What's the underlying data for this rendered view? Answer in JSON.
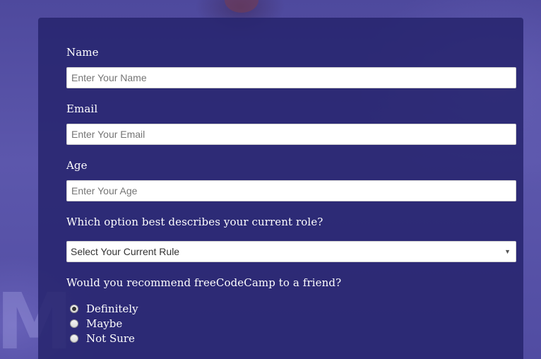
{
  "form": {
    "name": {
      "label": "Name",
      "placeholder": "Enter Your Name"
    },
    "email": {
      "label": "Email",
      "placeholder": "Enter Your Email"
    },
    "age": {
      "label": "Age",
      "placeholder": "Enter Your Age"
    },
    "role": {
      "label": "Which option best describes your current role?",
      "selected": "Select Your Current Rule"
    },
    "recommend": {
      "label": "Would you recommend freeCodeCamp to a friend?",
      "options": [
        {
          "label": "Definitely",
          "checked": true
        },
        {
          "label": "Maybe",
          "checked": false
        },
        {
          "label": "Not Sure",
          "checked": false
        }
      ]
    }
  },
  "background": {
    "watermark_letter": "M"
  },
  "colors": {
    "panel": "#27246e",
    "background": "#5b56a8",
    "text": "#ffffff"
  },
  "icons": {
    "select_arrow": "chevron-down-icon"
  }
}
